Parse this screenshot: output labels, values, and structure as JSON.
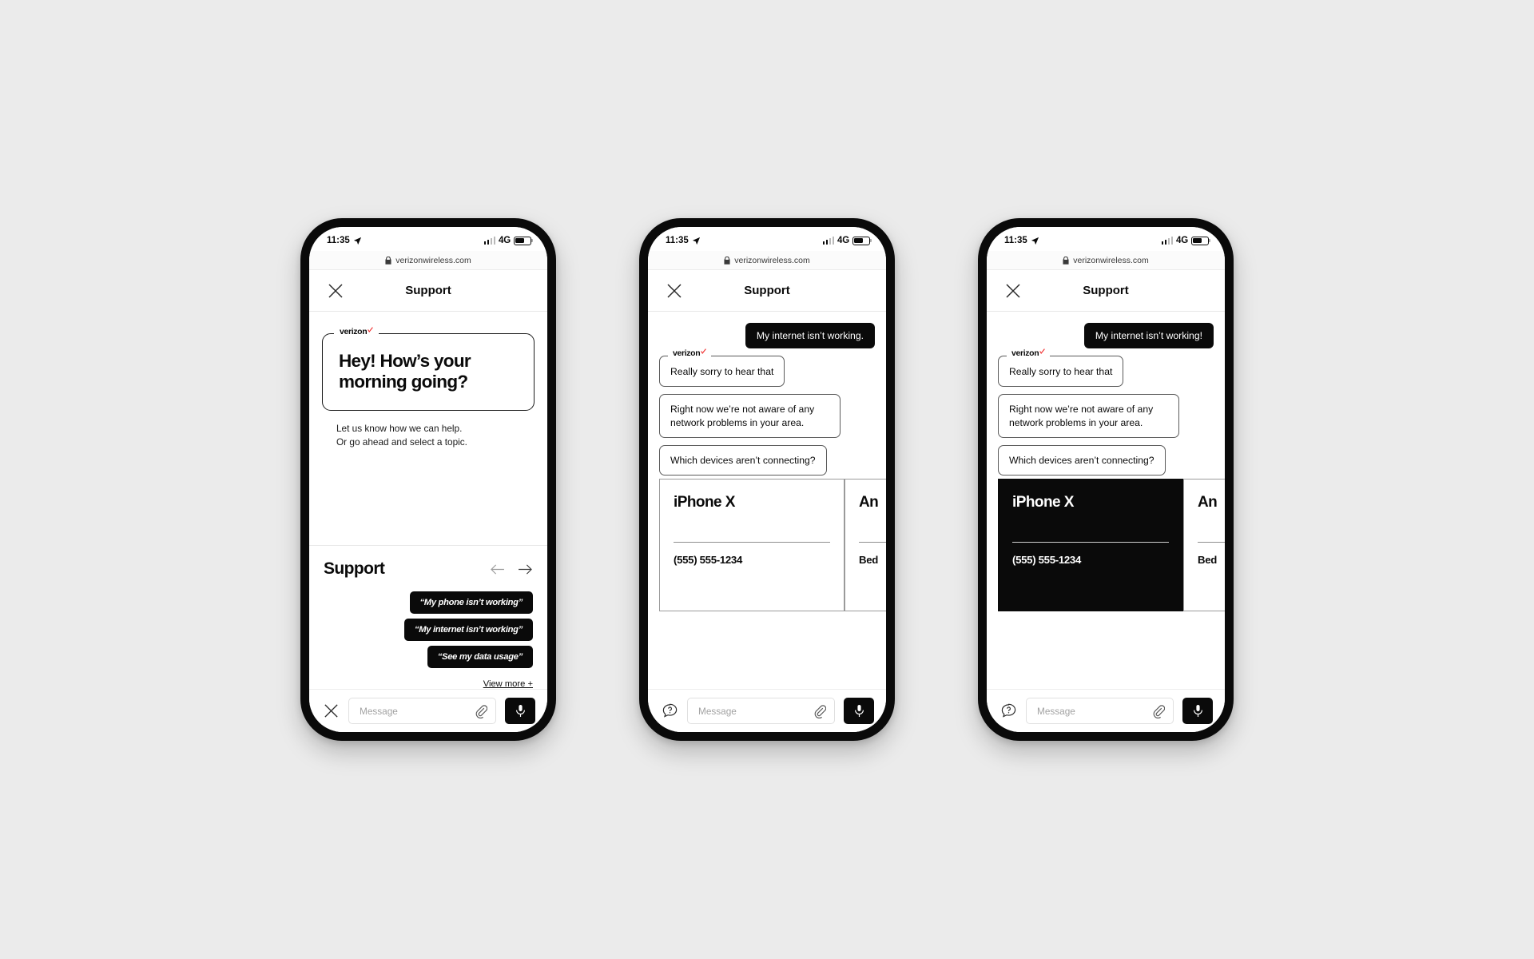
{
  "status_bar": {
    "time": "11:35",
    "network": "4G",
    "icons": {
      "location": "location-arrow-icon",
      "signal": "signal-bars-icon",
      "battery": "battery-icon"
    }
  },
  "browser": {
    "url": "verizonwireless.com",
    "lock_icon": "lock-icon"
  },
  "app_header": {
    "title": "Support",
    "close_icon": "close-icon"
  },
  "brand": {
    "name": "verizon",
    "check_color": "#f03232"
  },
  "screen1": {
    "hero": {
      "heading": "Hey! How’s your morning going?",
      "subtext": "Let us know how we can help.\nOr go ahead and select a topic."
    },
    "support": {
      "title": "Support",
      "prev_icon": "arrow-left-icon",
      "next_icon": "arrow-right-icon",
      "chips": [
        "“My phone isn’t working”",
        "“My internet isn’t working”",
        "“See my data usage”"
      ],
      "view_more": "View more +"
    },
    "composer": {
      "left_icon": "close-icon",
      "placeholder": "Message",
      "attach_icon": "paperclip-icon",
      "mic_icon": "microphone-icon"
    }
  },
  "screen2": {
    "messages": [
      {
        "from": "user",
        "text": "My internet isn’t working."
      },
      {
        "from": "agent",
        "text": "Really sorry to hear that",
        "branded": true
      },
      {
        "from": "agent",
        "text": "Right now we’re not aware of any network problems in your area.",
        "branded": false
      },
      {
        "from": "agent",
        "text": "Which devices aren’t connecting?",
        "branded": false
      }
    ],
    "devices": [
      {
        "name": "iPhone X",
        "detail": "(555) 555-1234",
        "selected": false
      },
      {
        "name": "An",
        "detail": "Bed",
        "selected": false
      }
    ],
    "composer": {
      "left_icon": "help-chat-icon",
      "placeholder": "Message",
      "attach_icon": "paperclip-icon",
      "mic_icon": "microphone-icon"
    }
  },
  "screen3": {
    "messages": [
      {
        "from": "user",
        "text": "My internet isn’t working!"
      },
      {
        "from": "agent",
        "text": "Really sorry to hear that",
        "branded": true
      },
      {
        "from": "agent",
        "text": "Right now we’re not aware of any network problems in your area.",
        "branded": false
      },
      {
        "from": "agent",
        "text": "Which devices aren’t connecting?",
        "branded": false
      }
    ],
    "devices": [
      {
        "name": "iPhone X",
        "detail": "(555) 555-1234",
        "selected": true
      },
      {
        "name": "An",
        "detail": "Bed",
        "selected": false
      }
    ],
    "composer": {
      "left_icon": "help-chat-icon",
      "placeholder": "Message",
      "attach_icon": "paperclip-icon",
      "mic_icon": "microphone-icon"
    }
  },
  "colors": {
    "background": "#ebebeb",
    "ink": "#0a0a0a",
    "frame": "#0a0a0a"
  }
}
